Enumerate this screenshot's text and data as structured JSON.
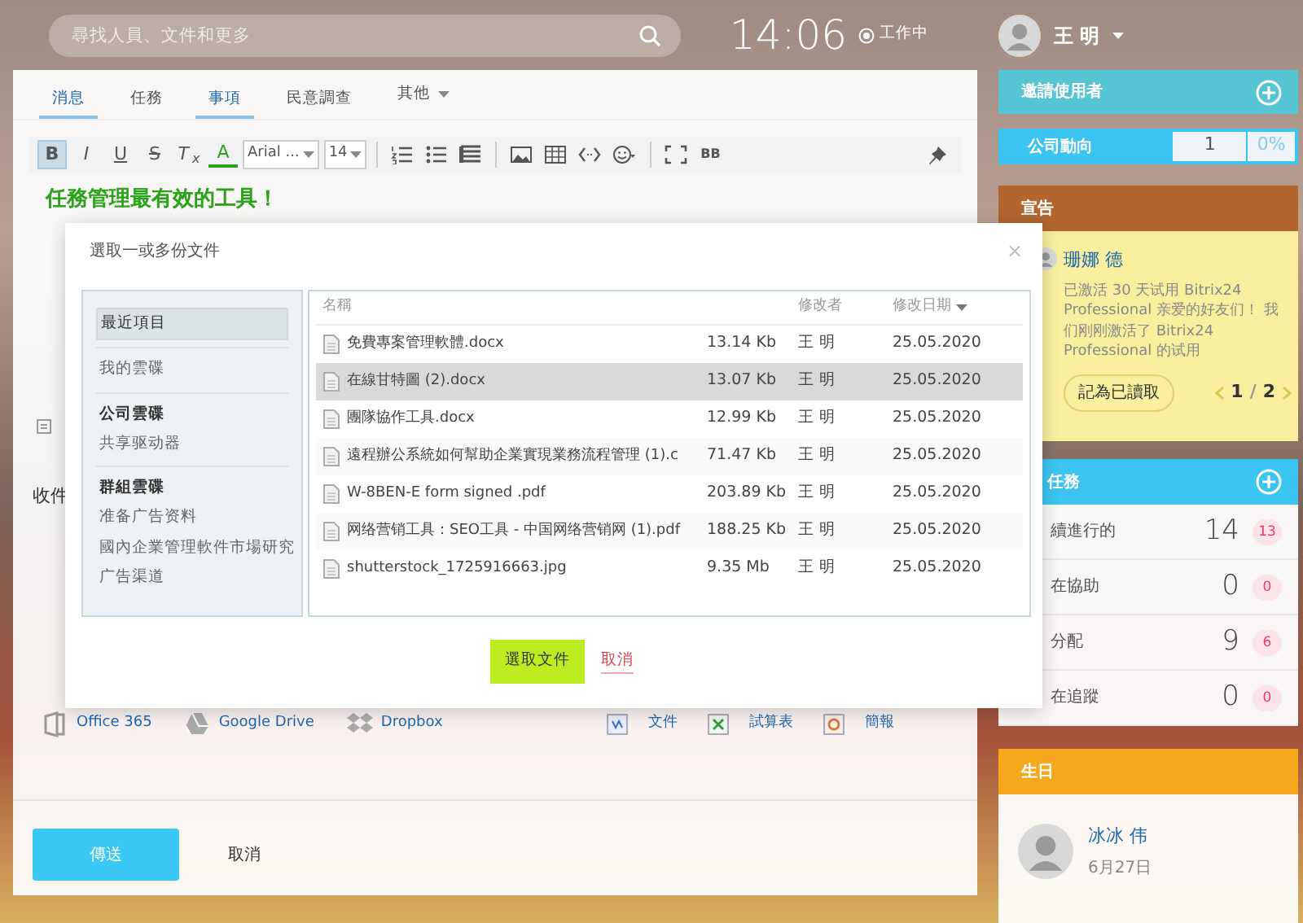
{
  "top_bar": {
    "search": {
      "placeholder": "尋找人員、文件和更多"
    },
    "clock": "14:06",
    "status": "工作中",
    "user": {
      "name": "王 明"
    }
  },
  "editor": {
    "tabs": [
      {
        "label": "消息",
        "selected": true,
        "dropdown": false
      },
      {
        "label": "任務",
        "selected": false,
        "dropdown": false
      },
      {
        "label": "事項",
        "selected": true,
        "dropdown": false
      },
      {
        "label": "民意調查",
        "selected": false,
        "dropdown": false
      },
      {
        "label": "其他",
        "selected": false,
        "dropdown": true
      }
    ],
    "toolbar": [
      {
        "kind": "format",
        "label": "B",
        "active": true
      },
      {
        "kind": "format",
        "label": "I",
        "active": false
      },
      {
        "kind": "format",
        "label": "U",
        "active": false
      },
      {
        "kind": "format",
        "label": "S",
        "active": false
      },
      {
        "kind": "format",
        "label": "T$_{x}$",
        "active": false
      },
      {
        "kind": "color",
        "label": "A",
        "active": false
      },
      {
        "kind": "select",
        "label": "Arial ...",
        "active": false
      },
      {
        "kind": "select",
        "label": "14",
        "active": false
      },
      {
        "kind": "separator"
      },
      {
        "kind": "olist",
        "active": false
      },
      {
        "kind": "ulist",
        "active": false
      },
      {
        "kind": "align",
        "active": false
      },
      {
        "kind": "separator"
      },
      {
        "kind": "image",
        "active": false
      },
      {
        "kind": "table",
        "active": false
      },
      {
        "kind": "code",
        "active": false
      },
      {
        "kind": "emoji",
        "active": false
      },
      {
        "kind": "separator"
      },
      {
        "kind": "fullscreen",
        "active": false
      },
      {
        "kind": "bbcode",
        "label": "BB",
        "active": false
      },
      {
        "kind": "pin",
        "active": false
      }
    ],
    "heading": "任務管理最有效的工具！",
    "recipients_label": "收件",
    "sources": [
      {
        "kind": "office",
        "label": "Office 365"
      },
      {
        "kind": "gdrive",
        "label": "Google Drive"
      },
      {
        "kind": "dropbox",
        "label": "Dropbox"
      }
    ],
    "create": [
      {
        "kind": "doc",
        "label": "文件"
      },
      {
        "kind": "sheet",
        "label": "試算表"
      },
      {
        "kind": "slides",
        "label": "簡報"
      }
    ],
    "send_button": "傳送",
    "cancel_button": "取消"
  },
  "dialog": {
    "title": "選取一或多份文件",
    "close": "×",
    "nav": [
      {
        "items": [
          {
            "label": "最近項目",
            "selected": true
          }
        ]
      },
      {
        "items": [
          {
            "label": "我的雲碟",
            "selected": false
          }
        ]
      },
      {
        "heading": "公司雲碟",
        "items": [
          {
            "label": "共享驱动器",
            "selected": false
          }
        ]
      },
      {
        "heading": "群組雲碟",
        "items": [
          {
            "label": "准备广告资料",
            "selected": false
          },
          {
            "label": "國內企業管理軟件市場研究",
            "selected": false
          },
          {
            "label": "广告渠道",
            "selected": false
          }
        ]
      }
    ],
    "columns": [
      {
        "label": "名稱"
      },
      {
        "label": "修改者"
      },
      {
        "label": "修改日期",
        "sorted": true
      }
    ],
    "rows": [
      {
        "name": "免費專案管理軟體.docx",
        "size": "13.14 Kb",
        "modified_by": "王 明",
        "date": "25.05.2020",
        "selected": false
      },
      {
        "name": "在線甘特圖 (2).docx",
        "size": "13.07 Kb",
        "modified_by": "王 明",
        "date": "25.05.2020",
        "selected": true
      },
      {
        "name": "團隊協作工具.docx",
        "size": "12.99 Kb",
        "modified_by": "王 明",
        "date": "25.05.2020",
        "selected": false
      },
      {
        "name": "遠程辦公系統如何幫助企業實現業務流程管理 (1).c",
        "size": "71.47 Kb",
        "modified_by": "王 明",
        "date": "25.05.2020",
        "selected": false
      },
      {
        "name": "W-8BEN-E form signed .pdf",
        "size": "203.89 Kb",
        "modified_by": "王 明",
        "date": "25.05.2020",
        "selected": false
      },
      {
        "name": "网络营销工具：SEO工具 - 中国网络营销网 (1).pdf",
        "size": "188.25 Kb",
        "modified_by": "王 明",
        "date": "25.05.2020",
        "selected": false
      },
      {
        "name": "shutterstock_1725916663.jpg",
        "size": "9.35 Mb",
        "modified_by": "王 明",
        "date": "25.05.2020",
        "selected": false
      }
    ],
    "select_button": "選取文件",
    "cancel_button": "取消"
  },
  "sidebar": {
    "invite": "邀請使用者",
    "pulse": {
      "label": "公司動向",
      "count": "1",
      "percent": "0%"
    },
    "announcement": {
      "title": "宣告",
      "author": "珊娜 德",
      "text": "已激活 30 天试用 Bitrix24 Professional 亲爱的好友们！ 我们刚刚激活了 Bitrix24 Professional 的试用",
      "mark_read": "記為已讀取",
      "page": "1",
      "separator": "/",
      "pages": "2"
    },
    "tasks": {
      "title": "任務",
      "rows": [
        {
          "label": "續進行的",
          "count": "14",
          "badge": "13"
        },
        {
          "label": "在協助",
          "count": "0",
          "badge": "0"
        },
        {
          "label": "分配",
          "count": "9",
          "badge": "6"
        },
        {
          "label": "在追蹤",
          "count": "0",
          "badge": "0"
        }
      ]
    },
    "birthdays": {
      "title": "生日",
      "people": [
        {
          "name": "冰冰 伟",
          "date": "6月27日"
        }
      ]
    }
  }
}
